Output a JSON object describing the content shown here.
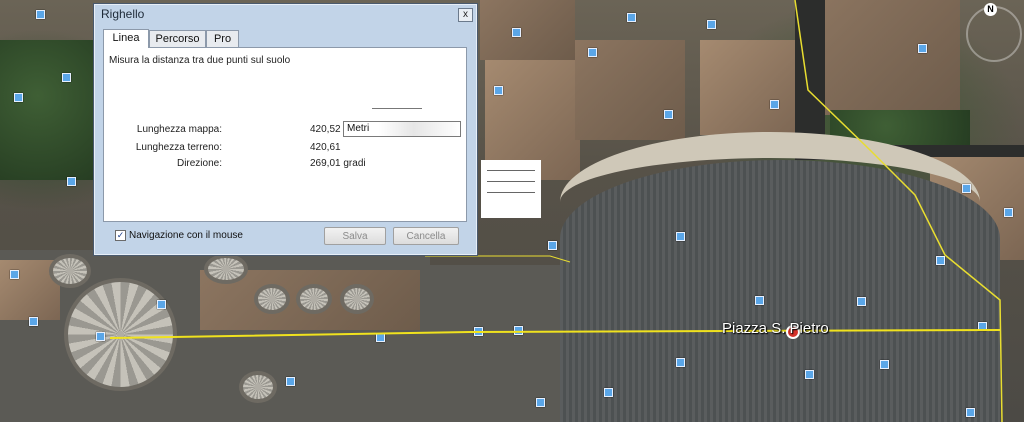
{
  "map": {
    "place_label": "Piazza S. Pietro",
    "compass_label": "N",
    "line_color": "#f0e21e",
    "poi_color": "#5aa6e8"
  },
  "dialog": {
    "title": "Righello",
    "close_label": "x",
    "tabs": [
      {
        "label": "Linea",
        "active": true
      },
      {
        "label": "Percorso",
        "active": false
      },
      {
        "label": "Pro",
        "active": false
      }
    ],
    "description": "Misura la distanza tra due punti sul suolo",
    "rows": [
      {
        "label": "Lunghezza mappa:",
        "value": "420,52"
      },
      {
        "label": "Lunghezza terreno:",
        "value": "420,61"
      },
      {
        "label": "Direzione:",
        "value": "269,01 gradi"
      }
    ],
    "unit_selected": "Metri",
    "navigation_checkbox": {
      "label": "Navigazione con il mouse",
      "checked": true
    },
    "buttons": {
      "save": "Salva",
      "clear": "Cancella"
    }
  }
}
